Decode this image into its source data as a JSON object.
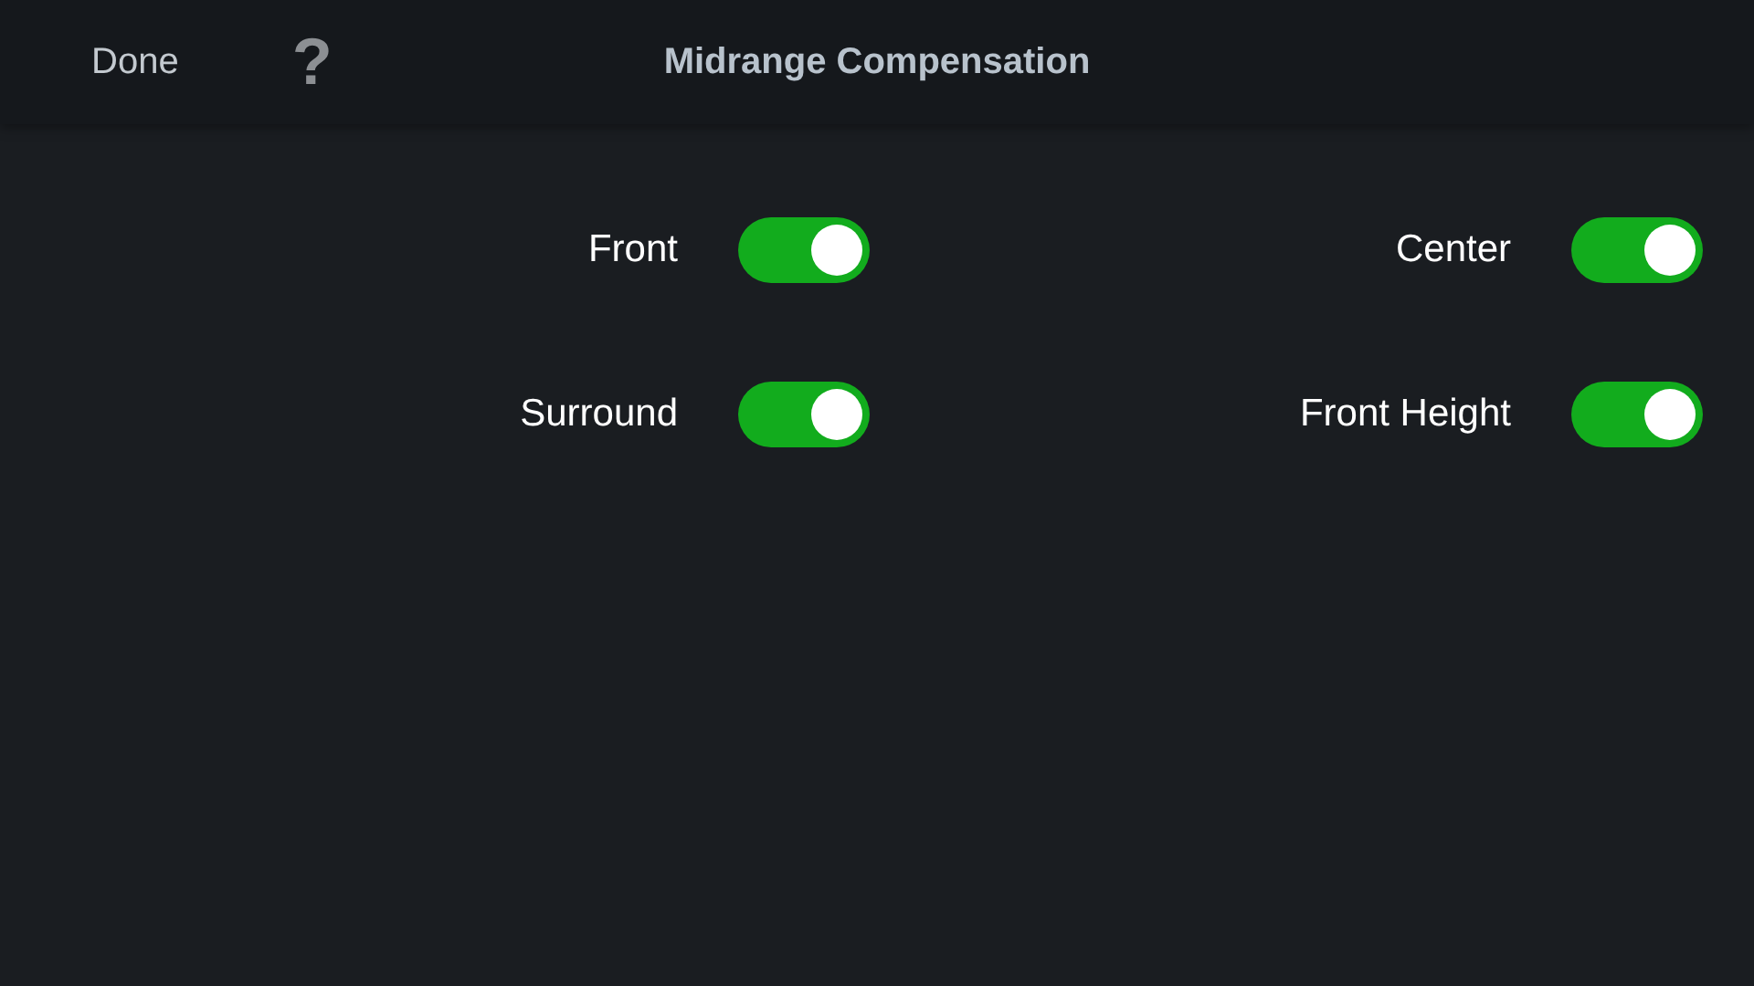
{
  "header": {
    "done_button": "Done",
    "help_button": "?",
    "title": "Midrange Compensation"
  },
  "settings": [
    {
      "label": "Front",
      "on": true
    },
    {
      "label": "Center",
      "on": true
    },
    {
      "label": "Surround",
      "on": true
    },
    {
      "label": "Front Height",
      "on": true
    }
  ]
}
